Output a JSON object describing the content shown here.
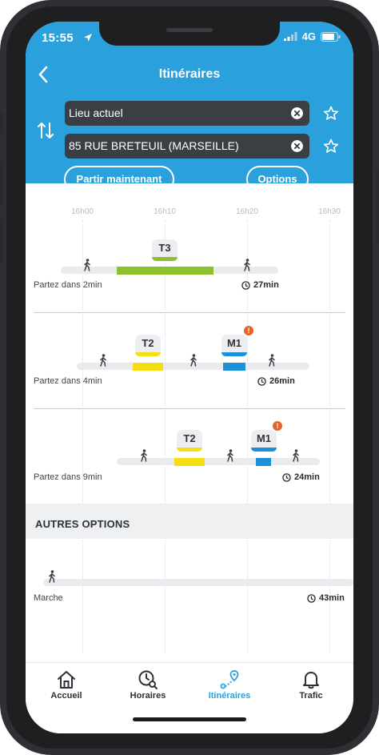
{
  "status": {
    "time": "15:55",
    "network": "4G"
  },
  "header": {
    "title": "Itinéraires"
  },
  "search": {
    "origin": "Lieu actuel",
    "destination": "85 RUE BRETEUIL (MARSEILLE)",
    "depart_button": "Partir maintenant",
    "options_button": "Options"
  },
  "timeline": {
    "ticks": [
      "16h00",
      "16h10",
      "16h20",
      "16h30"
    ]
  },
  "routes": [
    {
      "depart": "Partez dans 2min",
      "duration": "27min",
      "lines": [
        {
          "name": "T3",
          "color": "#8dc02d"
        }
      ]
    },
    {
      "depart": "Partez dans 4min",
      "duration": "26min",
      "lines": [
        {
          "name": "T2",
          "color": "#f5de13"
        },
        {
          "name": "M1",
          "color": "#1e90d8",
          "alert": "!"
        }
      ]
    },
    {
      "depart": "Partez dans 9min",
      "duration": "24min",
      "lines": [
        {
          "name": "T2",
          "color": "#f5de13"
        },
        {
          "name": "M1",
          "color": "#1e90d8",
          "alert": "!"
        }
      ]
    }
  ],
  "other_options": {
    "title": "AUTRES OPTIONS",
    "walk_label": "Marche",
    "walk_duration": "43min"
  },
  "tabs": [
    "Accueil",
    "Horaires",
    "Itinéraires",
    "Trafic"
  ],
  "colors": {
    "primary": "#2aa1dc",
    "active_tab": "#2aa1dc",
    "alert": "#e8632b"
  }
}
